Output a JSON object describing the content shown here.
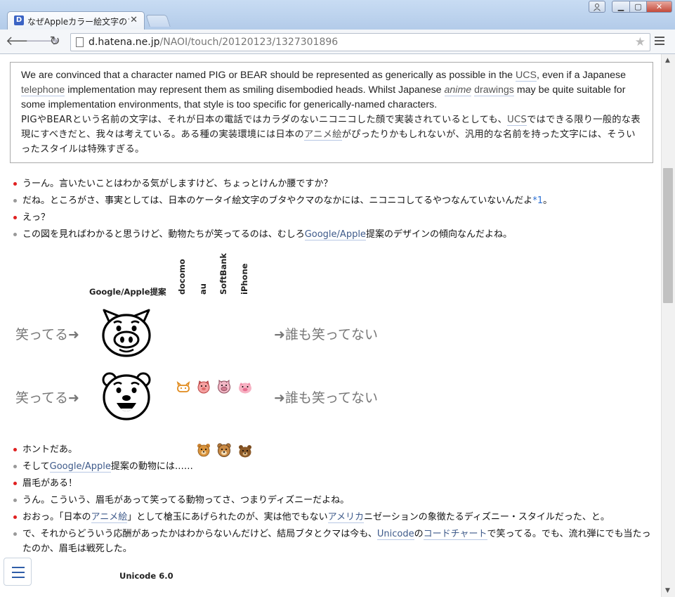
{
  "browser": {
    "tab_title": "なぜAppleカラー絵文字のフ",
    "tab_favicon": "D",
    "url_host": "d.hatena.ne.jp",
    "url_path": "/NAOI/touch/20120123/1327301896"
  },
  "quote": {
    "en_1": "We are convinced that a character named PIG or BEAR should be represented as generically as possible in the ",
    "en_ucs": "UCS",
    "en_2": ", even if a Japanese ",
    "en_telephone": "telephone",
    "en_3": " implementation may represent them as smiling disembodied heads. Whilst Japanese ",
    "en_anime": "anime",
    "en_4": " ",
    "en_drawings": "drawings",
    "en_5": " may be quite suitable for some implementation environments, that style is too specific for generically-named characters.",
    "jp_1": "PIGやBEARという名前の文字は、それが日本の電話ではカラダのないニコニコした顔で実装されているとしても、",
    "jp_ucs": "UCS",
    "jp_2": "ではできる限り一般的な表現にすべきだと、我々は考えている。ある種の実装環境には日本の",
    "jp_anime": "アニメ絵",
    "jp_3": "がぴったりかもしれないが、汎用的な名前を持った文字には、そういったスタイルは特殊すぎる。"
  },
  "dialogue_1": [
    {
      "text": "うーん。言いたいことはわかる気がしますけど、ちょっとけんか腰ですか？"
    },
    {
      "text": "だね。ところがさ、事実としては、日本のケータイ絵文字のブタやクマのなかには、ニコニコしてるやつなんていないんだよ",
      "fn": "*1",
      "tail": "。"
    },
    {
      "text": "えっ？"
    },
    {
      "pre": "この図を見ればわかると思うけど、動物たちが笑ってるのは、むしろ",
      "kw": "Google/Apple",
      "post": "提案のデザインの傾向なんだよね。"
    }
  ],
  "figure": {
    "google_apple_label": "Google/Apple提案",
    "columns": [
      "docomo",
      "au",
      "SoftBank",
      "iPhone"
    ],
    "laughing_label": "笑ってる➜",
    "nobody_label": "➜誰も笑ってない",
    "rows": [
      "pig",
      "bear"
    ]
  },
  "dialogue_2": [
    {
      "text": "ホントだあ。"
    },
    {
      "pre": "そして",
      "kw": "Google/Apple",
      "post": "提案の動物には……"
    },
    {
      "text": "眉毛がある！"
    },
    {
      "text": "うん。こういう、眉毛があって笑ってる動物ってさ、つまりディズニーだよね。"
    },
    {
      "pre": "おおっ。「日本の",
      "kw": "アニメ絵",
      "mid": "」として槍玉にあげられたのが、実は他でもない",
      "kw2": "アメリカ",
      "post": "ニゼーションの象徴たるディズニー・スタイルだった、と。"
    },
    {
      "pre": "で、それからどういう応酬があったかはわからないんだけど、結局ブタとクマは今も、",
      "kw": "Unicode",
      "mid": "の",
      "kw2": "コードチャート",
      "post": "で笑ってる。でも、流れ弾にでも当たったのか、眉毛は戦死した。"
    }
  ],
  "bottom": {
    "unicode_label": "Unicode 6.0"
  },
  "colors": {
    "bullet_red": "#e02020",
    "bullet_gray": "#999999",
    "link": "#2b6fd3"
  }
}
